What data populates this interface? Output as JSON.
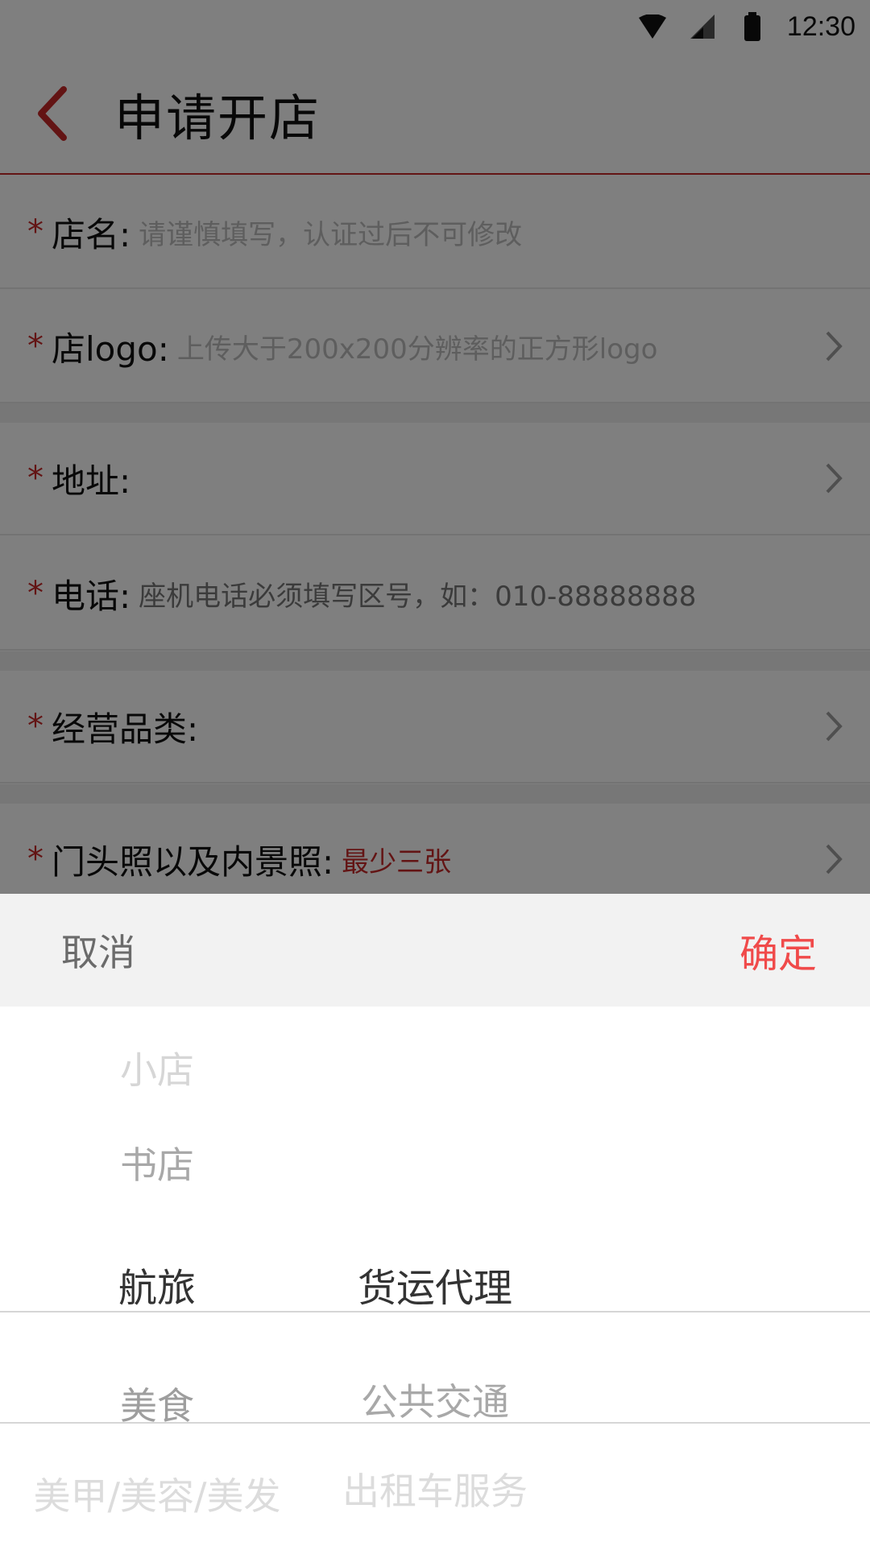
{
  "status_bar": {
    "time": "12:30"
  },
  "header": {
    "title": "申请开店"
  },
  "form": {
    "required_mark": "*",
    "rows": [
      {
        "label": "店名:",
        "value": "请谨慎填写，认证过后不可修改"
      },
      {
        "label": "店logo:",
        "value": "上传大于200x200分辨率的正方形logo"
      },
      {
        "label": "地址:",
        "value": ""
      },
      {
        "label": "电话:",
        "value": "座机电话必须填写区号，如：010-88888888"
      },
      {
        "label": "经营品类:",
        "value": ""
      },
      {
        "label": "门头照以及内景照:",
        "value": "最少三张"
      }
    ]
  },
  "picker": {
    "cancel_label": "取消",
    "confirm_label": "确定",
    "column1": [
      "小店",
      "书店",
      "航旅",
      "美食",
      "美甲/美容/美发"
    ],
    "column1_selected": "航旅",
    "column2": [
      "货运代理",
      "公共交通",
      "出租车服务"
    ],
    "column2_selected": "货运代理"
  },
  "colors": {
    "accent": "#c62828",
    "confirm": "#f04a4a"
  }
}
